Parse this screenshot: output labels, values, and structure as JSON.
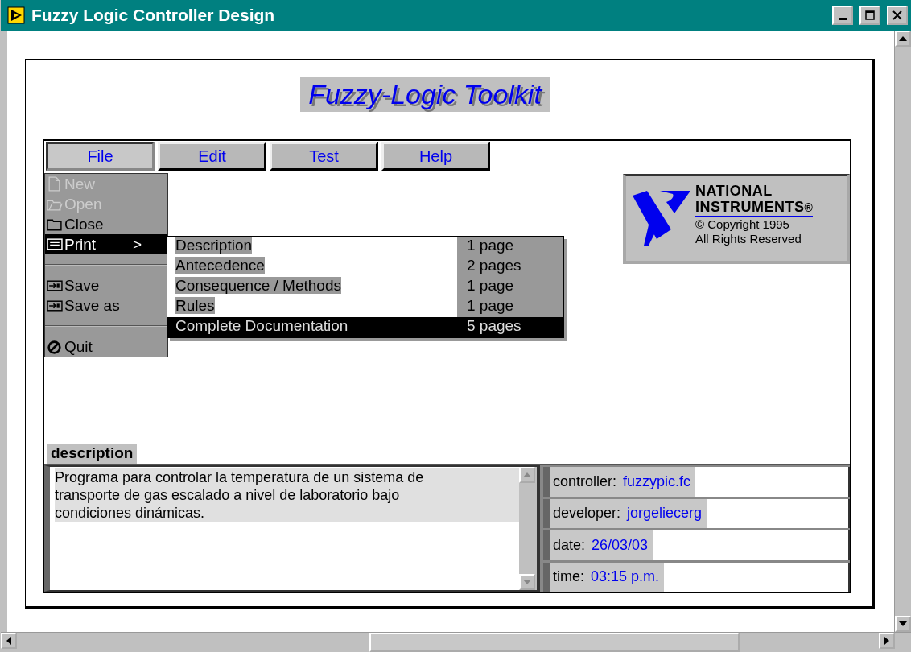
{
  "window": {
    "title": "Fuzzy Logic Controller Design"
  },
  "banner": {
    "title": "Fuzzy-Logic Toolkit"
  },
  "menu_bar": [
    {
      "label": "File",
      "selected": true
    },
    {
      "label": "Edit",
      "selected": false
    },
    {
      "label": "Test",
      "selected": false
    },
    {
      "label": "Help",
      "selected": false
    }
  ],
  "file_menu": [
    {
      "kind": "command",
      "label": "New",
      "disabled": true,
      "selected": false
    },
    {
      "kind": "command",
      "label": "Open",
      "disabled": true,
      "selected": false
    },
    {
      "kind": "command",
      "label": "Close",
      "disabled": false,
      "selected": false
    },
    {
      "kind": "command",
      "label": "Print",
      "disabled": false,
      "selected": true,
      "submenu_mark": ">"
    },
    {
      "kind": "separator"
    },
    {
      "kind": "command",
      "label": "Save",
      "disabled": false,
      "selected": false
    },
    {
      "kind": "command",
      "label": "Save as",
      "disabled": false,
      "selected": false
    },
    {
      "kind": "separator"
    },
    {
      "kind": "command",
      "label": "Quit",
      "disabled": false,
      "selected": false
    }
  ],
  "print_submenu": [
    {
      "label": "Description",
      "pages": "1 page",
      "selected": false
    },
    {
      "label": "Antecedence",
      "pages": "2 pages",
      "selected": false
    },
    {
      "label": "Consequence / Methods",
      "pages": "1 page",
      "selected": false
    },
    {
      "label": "Rules",
      "pages": "1 page",
      "selected": false
    },
    {
      "label": "Complete Documentation",
      "pages": "5 pages",
      "selected": true
    }
  ],
  "logo": {
    "line_1": "NATIONAL",
    "line_2": "INSTRUMENTS",
    "mark": "®",
    "copyright": "© Copyright 1995",
    "rights": "All Rights Reserved"
  },
  "description": {
    "label": "description",
    "text": "Programa para controlar la temperatura de un sistema de transporte de gas escalado a nivel de laboratorio bajo condiciones dinámicas."
  },
  "info_fields": [
    {
      "label": "controller:",
      "value": "fuzzypic.fc"
    },
    {
      "label": "developer:",
      "value": "jorgeliecerg"
    },
    {
      "label": "date:",
      "value": "26/03/03"
    },
    {
      "label": "time:",
      "value": "03:15 p.m."
    }
  ]
}
